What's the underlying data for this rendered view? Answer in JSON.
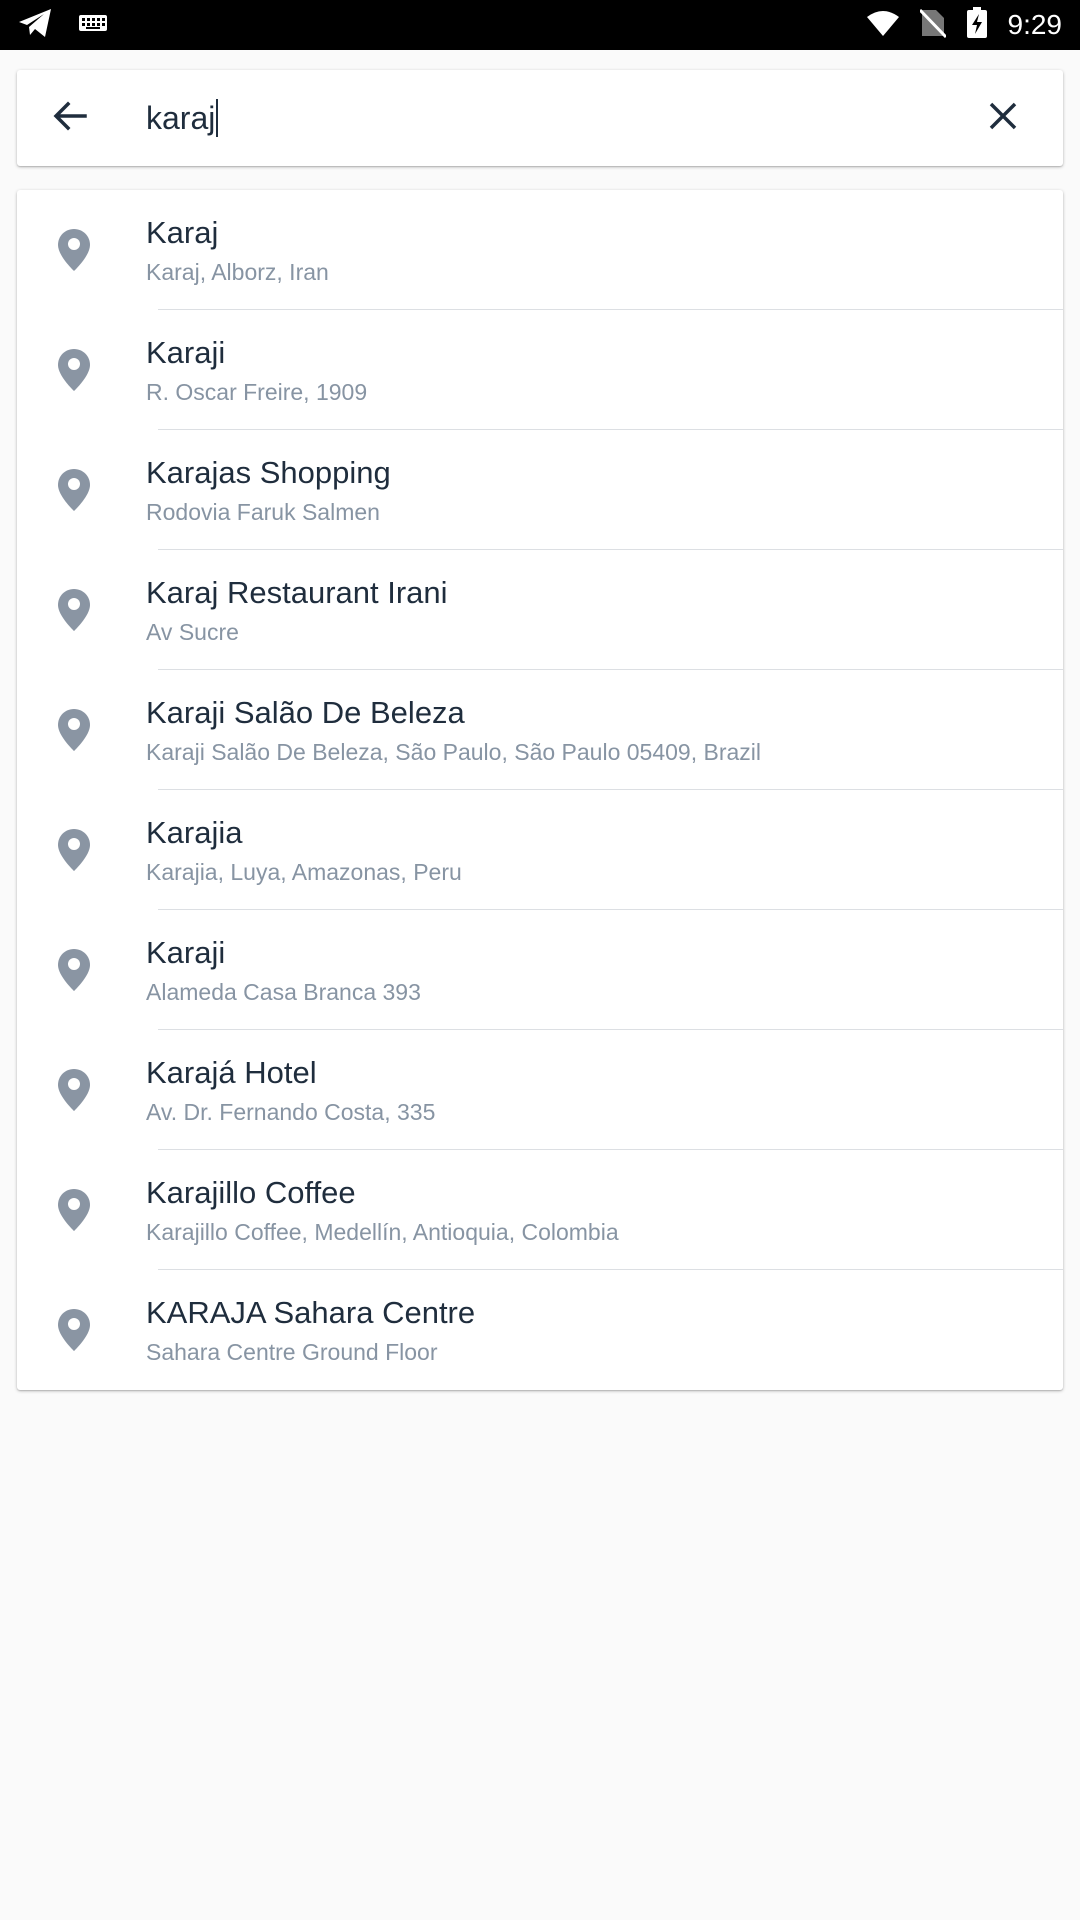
{
  "status_bar": {
    "time": "9:29",
    "icons": [
      "telegram-icon",
      "keyboard-icon",
      "wifi-icon",
      "no-sim-icon",
      "battery-charging-icon"
    ]
  },
  "search": {
    "value": "karaj",
    "back_icon": "arrow-left-icon",
    "clear_icon": "close-icon"
  },
  "results": [
    {
      "title": "Karaj",
      "subtitle": "Karaj, Alborz, Iran"
    },
    {
      "title": "Karaji",
      "subtitle": "R. Oscar Freire, 1909"
    },
    {
      "title": "Karajas Shopping",
      "subtitle": "Rodovia Faruk Salmen"
    },
    {
      "title": "Karaj Restaurant Irani",
      "subtitle": "Av Sucre"
    },
    {
      "title": "Karaji Salão De Beleza",
      "subtitle": "Karaji Salão De Beleza, São Paulo, São Paulo 05409, Brazil"
    },
    {
      "title": "Karajia",
      "subtitle": "Karajia, Luya, Amazonas, Peru"
    },
    {
      "title": "Karaji",
      "subtitle": "Alameda Casa Branca 393"
    },
    {
      "title": "Karajá Hotel",
      "subtitle": "Av. Dr. Fernando Costa, 335"
    },
    {
      "title": "Karajillo Coffee",
      "subtitle": "Karajillo Coffee, Medellín, Antioquia, Colombia"
    },
    {
      "title": "KARAJA Sahara Centre",
      "subtitle": "Sahara Centre Ground Floor"
    }
  ],
  "colors": {
    "text_primary": "#1f2d3d",
    "text_secondary": "#8794a3",
    "pin": "#8a95a3",
    "background": "#fafafa"
  }
}
